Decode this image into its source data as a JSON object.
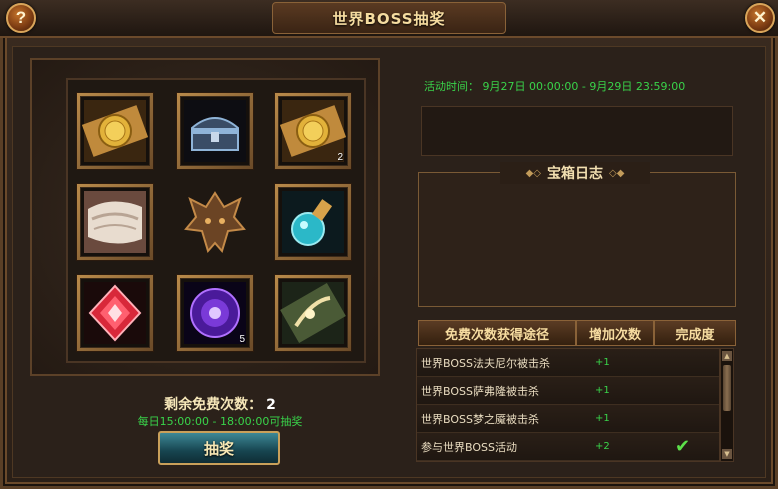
{
  "window": {
    "title": "世界BOSS抽奖",
    "help_label": "?",
    "close_label": "✕"
  },
  "reward_grid": {
    "slots": [
      {
        "icon": "gold-coin-card-icon",
        "count": ""
      },
      {
        "icon": "treasure-chest-icon",
        "count": ""
      },
      {
        "icon": "gold-coin-card-icon",
        "count": "2"
      },
      {
        "icon": "white-cloth-icon",
        "count": ""
      },
      {
        "icon": "blue-potion-icon",
        "count": ""
      },
      {
        "icon": "red-gem-icon",
        "count": ""
      },
      {
        "icon": "purple-orb-icon",
        "count": "5"
      },
      {
        "icon": "green-scroll-card-icon",
        "count": ""
      }
    ],
    "center_icon": "boss-head-emblem-icon"
  },
  "free_draws": {
    "label": "剩余免费次数：",
    "value": "2",
    "time_note": "每日15:00:00 - 18:00:00可抽奖"
  },
  "draw_button": {
    "label": "抽奖"
  },
  "activity": {
    "time_text": "活动时间： 9月27日 00:00:00 - 9月29日 23:59:00"
  },
  "log": {
    "title": "宝箱日志"
  },
  "tabs": [
    {
      "label": "免费次数获得途径"
    },
    {
      "label": "增加次数"
    },
    {
      "label": "完成度"
    }
  ],
  "tasks": [
    {
      "name": "世界BOSS法夫尼尔被击杀",
      "bonus": "+1",
      "done": ""
    },
    {
      "name": "世界BOSS萨弗隆被击杀",
      "bonus": "+1",
      "done": ""
    },
    {
      "name": "世界BOSS梦之魇被击杀",
      "bonus": "+1",
      "done": ""
    },
    {
      "name": "参与世界BOSS活动",
      "bonus": "+2",
      "done": "✔"
    }
  ],
  "colors": {
    "accent_gold": "#f6dca0",
    "green_text": "#39d34a",
    "frame_brown": "#6b4a2b",
    "button_teal": "#174550"
  }
}
